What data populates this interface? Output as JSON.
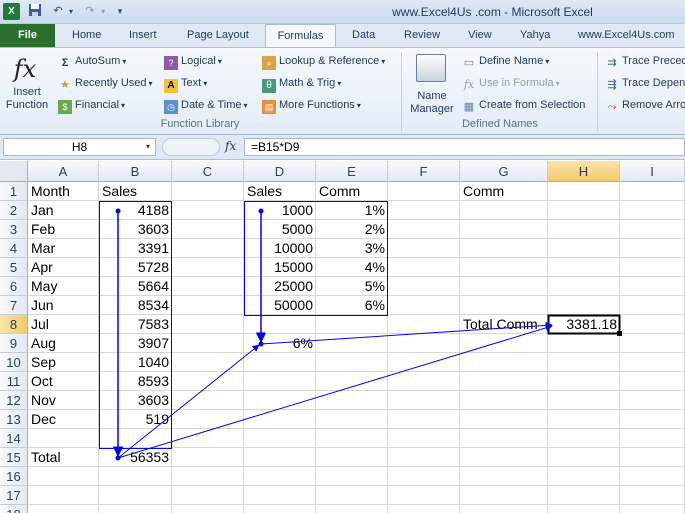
{
  "titlebar": {
    "app_icon": "X",
    "window_title": "www.Excel4Us .com - Microsoft Excel",
    "icons": [
      "excel-app-icon",
      "save-icon",
      "undo-icon",
      "redo-icon",
      "customize-quick-access-icon"
    ]
  },
  "tabs": [
    "File",
    "Home",
    "Insert",
    "Page Layout",
    "Formulas",
    "Data",
    "Review",
    "View",
    "Yahya",
    "www.Excel4Us.com"
  ],
  "active_tab": "Formulas",
  "ribbon": {
    "insert_function": {
      "line1": "Insert",
      "line2": "Function",
      "icon": "fx"
    },
    "function_library": {
      "autosum": "AutoSum",
      "recently_used": "Recently Used",
      "financial": "Financial",
      "logical": "Logical",
      "text": "Text",
      "date_time": "Date & Time",
      "lookup_reference": "Lookup & Reference",
      "math_trig": "Math & Trig",
      "more_functions": "More Functions",
      "group_label": "Function Library"
    },
    "defined_names": {
      "name_manager_line1": "Name",
      "name_manager_line2": "Manager",
      "define_name": "Define Name",
      "use_in_formula": "Use in Formula",
      "create_from_selection": "Create from Selection",
      "group_label": "Defined Names"
    },
    "formula_auditing": {
      "trace_precedents": "Trace Preced",
      "trace_dependents": "Trace Depen",
      "remove_arrows": "Remove Arro"
    }
  },
  "formula_bar": {
    "name_box": "H8",
    "fx": "fx",
    "formula": "=B15*D9"
  },
  "sheet": {
    "columns": [
      "A",
      "B",
      "C",
      "D",
      "E",
      "F",
      "G",
      "H",
      "I"
    ],
    "selected_column": "H",
    "rows": [
      "1",
      "2",
      "3",
      "4",
      "5",
      "6",
      "7",
      "8",
      "9",
      "10",
      "11",
      "12",
      "13",
      "14",
      "15",
      "16",
      "17",
      "18"
    ],
    "selected_row": "8",
    "cells": {
      "A1": "Month",
      "B1": "Sales",
      "D1": "Sales",
      "E1": "Comm",
      "G1": "Comm",
      "A2": "Jan",
      "B2": "4188",
      "D2": "1000",
      "E2": "1%",
      "A3": "Feb",
      "B3": "3603",
      "D3": "5000",
      "E3": "2%",
      "A4": "Mar",
      "B4": "3391",
      "D4": "10000",
      "E4": "3%",
      "A5": "Apr",
      "B5": "5728",
      "D5": "15000",
      "E5": "4%",
      "A6": "May",
      "B6": "5664",
      "D6": "25000",
      "E6": "5%",
      "A7": "Jun",
      "B7": "8534",
      "D7": "50000",
      "E7": "6%",
      "A8": "Jul",
      "B8": "7583",
      "G8": "Total Comm",
      "H8": "3381.18",
      "A9": "Aug",
      "B9": "3907",
      "D9": "6%",
      "A10": "Sep",
      "B10": "1040",
      "A11": "Oct",
      "B11": "8593",
      "A12": "Nov",
      "B12": "3603",
      "A13": "Dec",
      "B13": "519",
      "A15": "Total",
      "B15": "56353"
    },
    "trace_color": "#0000ff",
    "active_cell": "H8"
  }
}
